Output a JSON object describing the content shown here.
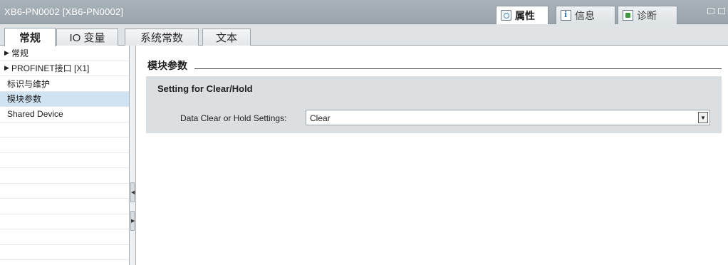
{
  "window": {
    "title": "XB6-PN0002 [XB6-PN0002]"
  },
  "panel_tabs": [
    {
      "label": "属性",
      "icon": "properties-icon",
      "active": true
    },
    {
      "label": "信息",
      "icon": "info-icon",
      "active": false
    },
    {
      "label": "诊断",
      "icon": "diagnostics-icon",
      "active": false
    }
  ],
  "main_tabs": [
    {
      "label": "常规",
      "active": true
    },
    {
      "label": "IO 变量",
      "active": false
    },
    {
      "label": "系统常数",
      "active": false
    },
    {
      "label": "文本",
      "active": false
    }
  ],
  "nav": {
    "items": [
      {
        "label": "常规",
        "expandable": true,
        "selected": false
      },
      {
        "label": "PROFINET接口 [X1]",
        "expandable": true,
        "selected": false
      },
      {
        "label": "标识与维护",
        "expandable": false,
        "selected": false
      },
      {
        "label": "模块参数",
        "expandable": false,
        "selected": true
      },
      {
        "label": "Shared Device",
        "expandable": false,
        "selected": false
      }
    ]
  },
  "content": {
    "section_title": "模块参数",
    "group_title": "Setting for Clear/Hold",
    "field_label": "Data Clear or Hold Settings:",
    "field_value": "Clear"
  },
  "colors": {
    "titlebar": "#a3adb4",
    "selected_row": "#cfe3f3",
    "panel_bg": "#dcdfe1"
  }
}
